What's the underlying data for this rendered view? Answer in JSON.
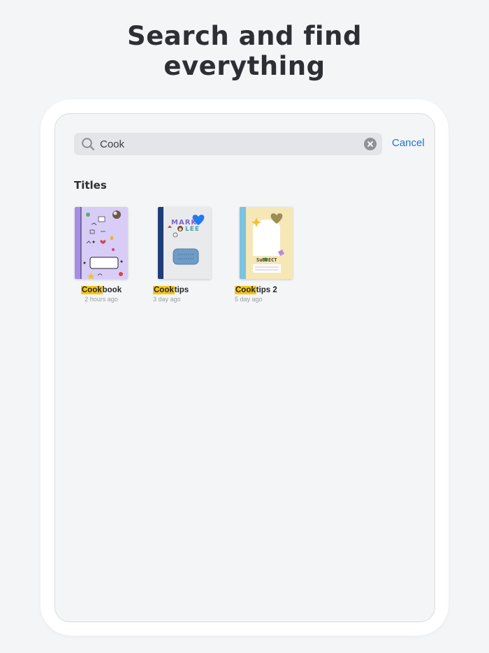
{
  "headline": {
    "line1": "Search and find",
    "line2": "everything"
  },
  "search": {
    "value": "Cook",
    "cancel_label": "Cancel"
  },
  "results_section": {
    "title": "Titles"
  },
  "results": [
    {
      "highlight": "Cook",
      "rest": "book",
      "time": "2 hours ago",
      "cover_color": "#d8cdf7",
      "spine_color": "#a58ee8"
    },
    {
      "highlight": "Cook",
      "rest": "tips",
      "time": "3 day ago",
      "cover_color": "#e9eaec",
      "spine_color": "#1d3d7a"
    },
    {
      "highlight": "Cook",
      "rest": "tips 2",
      "time": "5 day ago",
      "cover_color": "#f6e7b6",
      "spine_color": "#7cc3de"
    }
  ],
  "cover_texts": {
    "cooktips_top": "MARK",
    "cooktips_bottom": "LEE",
    "cooktips2_label": "SuBJECT"
  },
  "colors": {
    "accent": "#1a73d9",
    "highlight": "#f5c518"
  }
}
